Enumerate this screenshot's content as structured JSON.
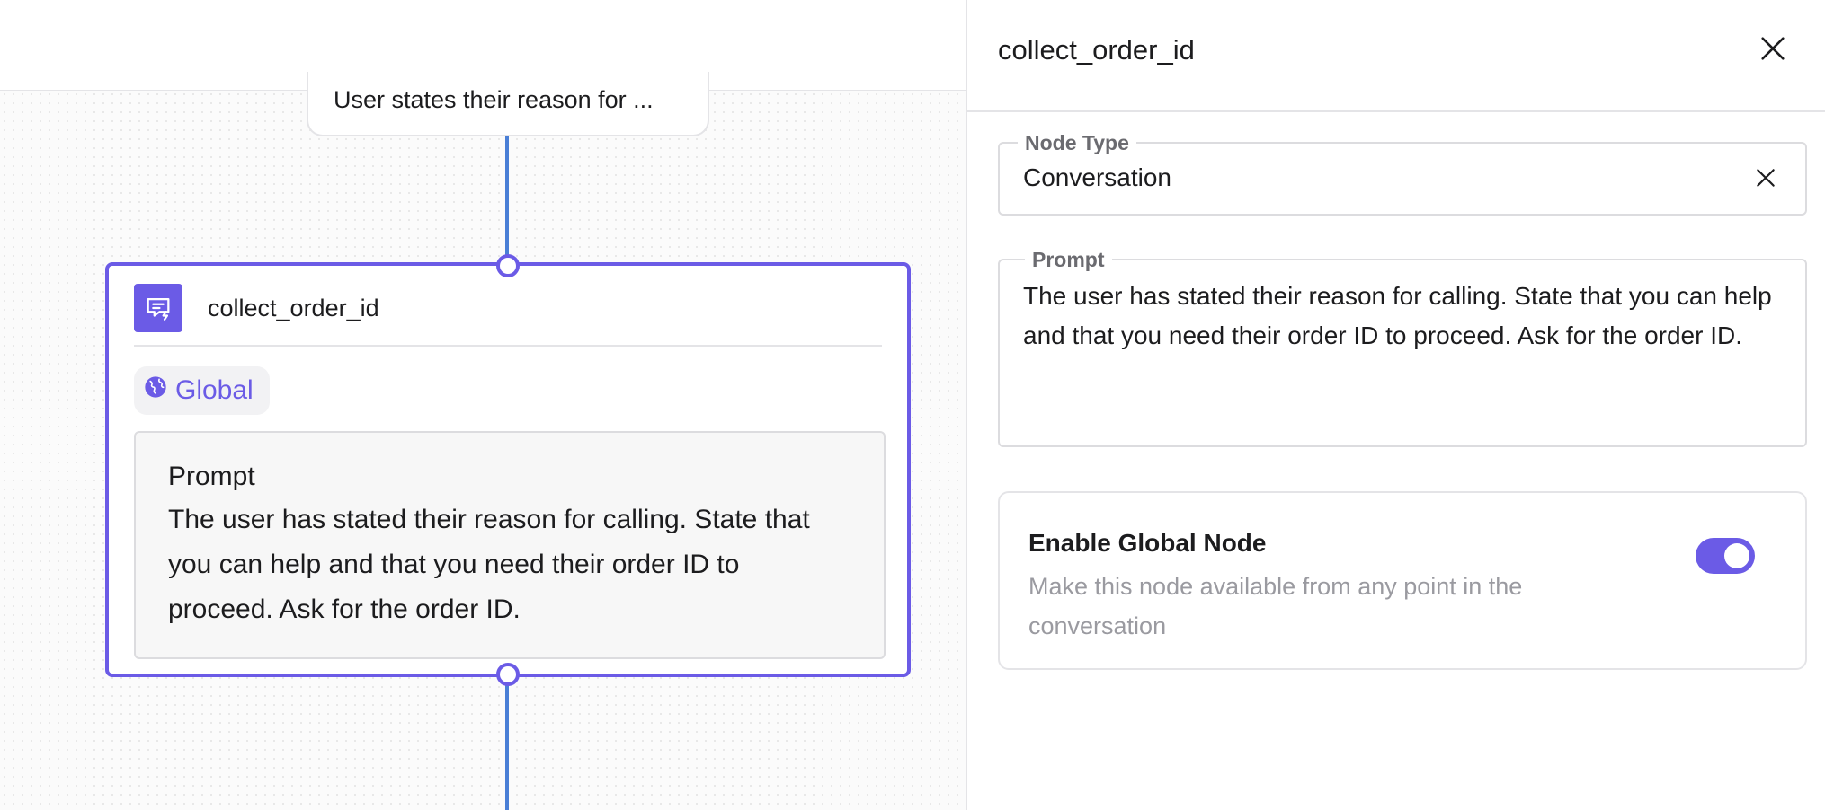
{
  "canvas": {
    "previous_node": {
      "text": "User states their reason for ..."
    },
    "node": {
      "title": "collect_order_id",
      "icon": "message-bolt-icon",
      "badge": {
        "icon": "globe-icon",
        "label": "Global"
      },
      "prompt": {
        "label": "Prompt",
        "text": "The user has stated their reason for calling. State that you can help and that you need their order ID to proceed. Ask for the order ID."
      }
    }
  },
  "panel": {
    "title": "collect_order_id",
    "close_icon": "close-icon",
    "node_type": {
      "label": "Node Type",
      "value": "Conversation",
      "clear_icon": "close-icon"
    },
    "prompt": {
      "label": "Prompt",
      "value": "The user has stated their reason for calling. State that you can help and that you need their order ID to proceed. Ask for the order ID."
    },
    "global_node": {
      "title": "Enable Global Node",
      "description": "Make this node available from any point in the conversation",
      "enabled": true
    }
  },
  "colors": {
    "accent": "#6b5be6",
    "edge": "#4a7fd6",
    "border": "#e4e4e7",
    "muted_text": "#9a9aa0"
  }
}
